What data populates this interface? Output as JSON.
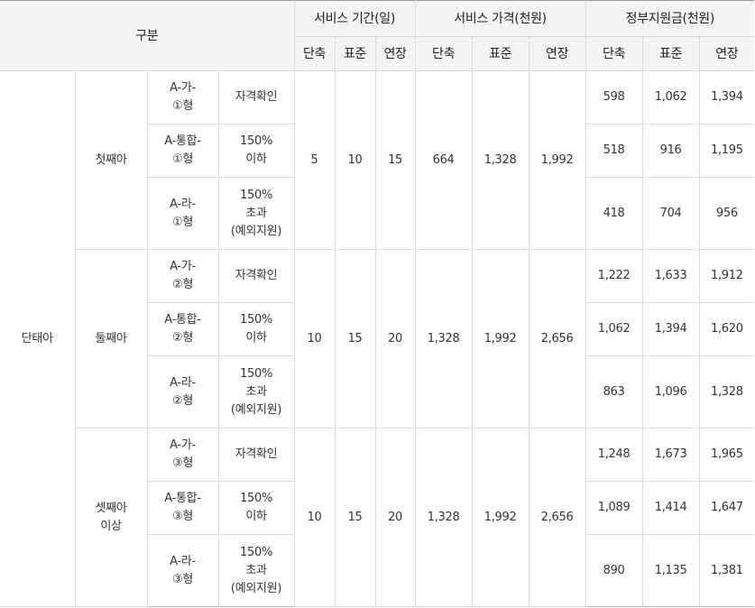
{
  "header": {
    "category": "구분",
    "groups": [
      "서비스 기간(일)",
      "서비스 가격(천원)",
      "정부지원금(천원)"
    ],
    "subcols": [
      "단축",
      "표준",
      "연장"
    ]
  },
  "section": "단태아",
  "children": [
    {
      "label_lines": [
        "첫째아"
      ],
      "days": [
        "5",
        "10",
        "15"
      ],
      "price": [
        "664",
        "1,328",
        "1,992"
      ],
      "rows": [
        {
          "type_lines": [
            "A-가-",
            "①형"
          ],
          "cond_lines": [
            "자격확인"
          ],
          "subsidy": [
            "598",
            "1,062",
            "1,394"
          ]
        },
        {
          "type_lines": [
            "A-통합-",
            "①형"
          ],
          "cond_lines": [
            "150%",
            "이하"
          ],
          "subsidy": [
            "518",
            "916",
            "1,195"
          ]
        },
        {
          "type_lines": [
            "A-라-",
            "①형"
          ],
          "cond_lines": [
            "150%",
            "초과",
            "(예외지원)"
          ],
          "subsidy": [
            "418",
            "704",
            "956"
          ]
        }
      ]
    },
    {
      "label_lines": [
        "둘째아"
      ],
      "days": [
        "10",
        "15",
        "20"
      ],
      "price": [
        "1,328",
        "1,992",
        "2,656"
      ],
      "rows": [
        {
          "type_lines": [
            "A-가-",
            "②형"
          ],
          "cond_lines": [
            "자격확인"
          ],
          "subsidy": [
            "1,222",
            "1,633",
            "1,912"
          ]
        },
        {
          "type_lines": [
            "A-통합-",
            "②형"
          ],
          "cond_lines": [
            "150%",
            "이하"
          ],
          "subsidy": [
            "1,062",
            "1,394",
            "1,620"
          ]
        },
        {
          "type_lines": [
            "A-라-",
            "②형"
          ],
          "cond_lines": [
            "150%",
            "초과",
            "(예외지원)"
          ],
          "subsidy": [
            "863",
            "1,096",
            "1,328"
          ]
        }
      ]
    },
    {
      "label_lines": [
        "셋째아",
        "이상"
      ],
      "days": [
        "10",
        "15",
        "20"
      ],
      "price": [
        "1,328",
        "1,992",
        "2,656"
      ],
      "rows": [
        {
          "type_lines": [
            "A-가-",
            "③형"
          ],
          "cond_lines": [
            "자격확인"
          ],
          "subsidy": [
            "1,248",
            "1,673",
            "1,965"
          ]
        },
        {
          "type_lines": [
            "A-통합-",
            "③형"
          ],
          "cond_lines": [
            "150%",
            "이하"
          ],
          "subsidy": [
            "1,089",
            "1,414",
            "1,647"
          ]
        },
        {
          "type_lines": [
            "A-라-",
            "③형"
          ],
          "cond_lines": [
            "150%",
            "초과",
            "(예외지원)"
          ],
          "subsidy": [
            "890",
            "1,135",
            "1,381"
          ]
        }
      ]
    }
  ]
}
